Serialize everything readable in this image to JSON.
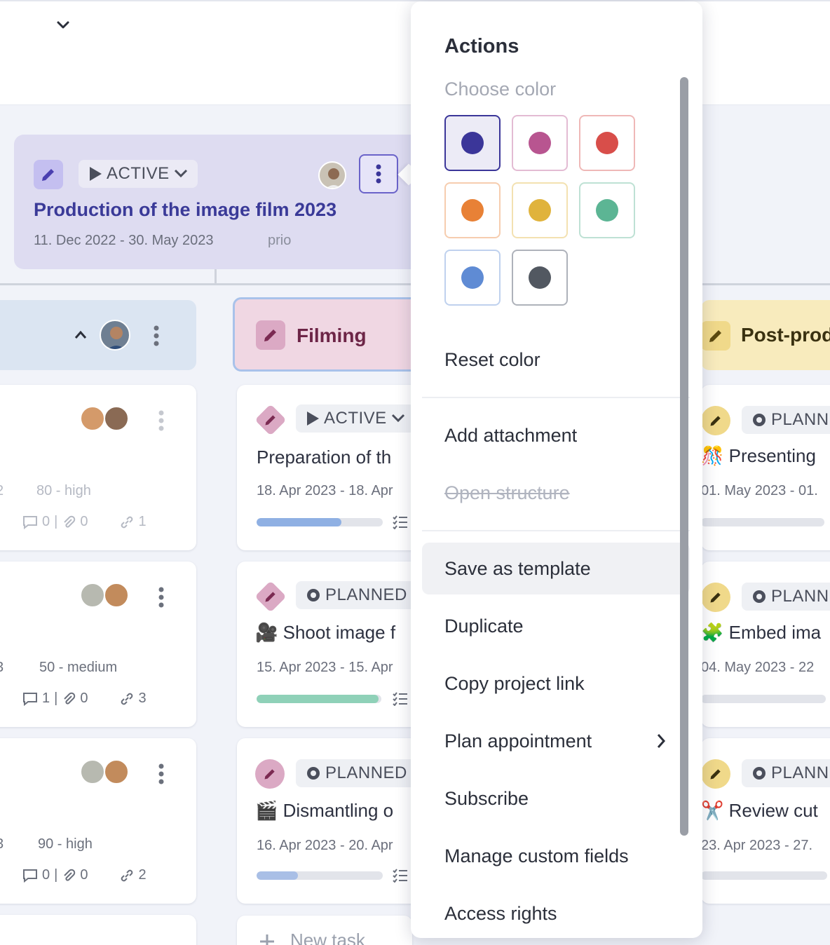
{
  "project": {
    "status": "ACTIVE",
    "title": "Production of the image film 2023",
    "dates": "11. Dec 2022 - 30. May 2023",
    "prio": "prio"
  },
  "columns": [
    {
      "title": ""
    },
    {
      "title": "Filming"
    },
    {
      "title": "Post-prod"
    }
  ],
  "left_tasks": [
    {
      "meta_left": "2",
      "meta_right": "80 - high",
      "comments": "0",
      "attachments": "0",
      "links": "1"
    },
    {
      "meta_left": "3",
      "meta_right": "50 - medium",
      "comments": "1",
      "attachments": "0",
      "links": "3"
    },
    {
      "meta_left": "3",
      "meta_right": "90 - high",
      "comments": "0",
      "attachments": "0",
      "links": "2"
    }
  ],
  "filming_tasks": [
    {
      "status": "ACTIVE",
      "title": "Preparation of th",
      "dates": "18. Apr 2023 - 18. Apr",
      "progress": 0.67,
      "color": "#8fb0e3"
    },
    {
      "status": "PLANNED",
      "title": "Shoot image f",
      "emoji": "🎥",
      "dates": "15. Apr 2023 - 15. Apr",
      "progress": 0.98,
      "color": "#8fd1b8"
    },
    {
      "status": "PLANNED",
      "title": "Dismantling o",
      "emoji": "🎬",
      "dates": "16. Apr 2023 - 20. Apr",
      "progress": 0.33,
      "color": "#a9bfe6"
    }
  ],
  "new_task_label": "New task",
  "postprod_tasks": [
    {
      "status": "PLANN",
      "title": "Presenting",
      "emoji": "🎊",
      "dates": "01. May 2023 - 01."
    },
    {
      "status": "PLANN",
      "title": "Embed ima",
      "emoji": "🧩",
      "dates": "04. May 2023 - 22"
    },
    {
      "status": "PLANN",
      "title": "Review cut",
      "emoji": "✂️",
      "dates": "23. Apr 2023 - 27."
    }
  ],
  "menu": {
    "title": "Actions",
    "choose_color": "Choose color",
    "colors": [
      "#3b3699",
      "#b85590",
      "#d84e4a",
      "#e88136",
      "#e0b33c",
      "#5cb594",
      "#5f8bd4",
      "#525861"
    ],
    "reset_color": "Reset color",
    "add_attachment": "Add attachment",
    "open_structure": "Open structure",
    "save_as_template": "Save as template",
    "duplicate": "Duplicate",
    "copy_project_link": "Copy project link",
    "plan_appointment": "Plan appointment",
    "subscribe": "Subscribe",
    "manage_custom_fields": "Manage custom fields",
    "access_rights": "Access rights"
  }
}
